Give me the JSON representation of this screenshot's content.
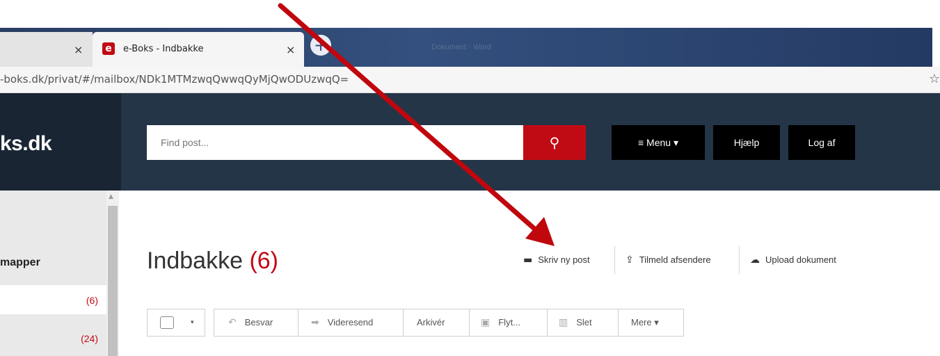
{
  "browser": {
    "inactive_tab_close": "×",
    "active_tab": {
      "favicon": "e",
      "title": "e-Boks - Indbakke",
      "close": "×"
    },
    "new_tab_icon": "+",
    "background_title": "Dokument · Word",
    "url": "-boks.dk/privat/#/mailbox/NDk1MTMzwqQwwqQyMjQwODUzwqQ=",
    "bookmark_icon": "☆"
  },
  "header": {
    "logo": "ks.dk",
    "search_placeholder": "Find post...",
    "search_icon": "⚲",
    "menu_label": "≡  Menu ▾",
    "help_label": "Hjælp",
    "logout_label": "Log af"
  },
  "sidebar": {
    "section_title": "mapper",
    "items": [
      {
        "count": "(6)"
      },
      {
        "count": "(24)"
      }
    ]
  },
  "main": {
    "title": "Indbakke",
    "title_count": "(6)",
    "actions": [
      {
        "icon": "▬",
        "label": "Skriv ny post"
      },
      {
        "icon": "⇪",
        "label": "Tilmeld afsendere"
      },
      {
        "icon": "☁",
        "label": "Upload dokument"
      }
    ],
    "toolbar": {
      "select_caret": "▾",
      "reply": {
        "icon": "↶",
        "label": "Besvar"
      },
      "forward": {
        "icon": "➡",
        "label": "Videresend"
      },
      "archive": {
        "label": "Arkivér"
      },
      "move": {
        "icon": "▣",
        "label": "Flyt..."
      },
      "delete": {
        "icon": "▥",
        "label": "Slet"
      },
      "more": {
        "label": "Mere ▾"
      }
    }
  },
  "colors": {
    "brand_red": "#c10b14",
    "header_bg": "#243547",
    "annotation_arrow": "#c0070e"
  }
}
